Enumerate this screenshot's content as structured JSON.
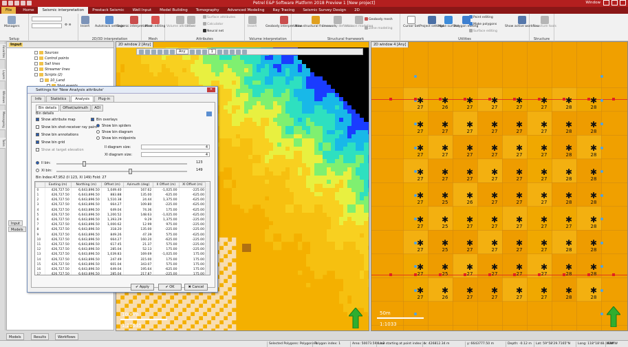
{
  "app": {
    "title": "Petrel E&P Software Platform 2018 Preview 1 [New project]",
    "window_menu": "Window",
    "quick_access_icons": [
      "save-icon",
      "undo-icon",
      "redo-icon",
      "print-icon",
      "folder-icon"
    ]
  },
  "tabs": [
    "File",
    "Home",
    "Seismic interpretation",
    "Prestack Seismic",
    "Well Input",
    "Model Building",
    "Tomography",
    "Advanced Modeling",
    "Ray Tracing",
    "Seismic Survey Design",
    "2D"
  ],
  "active_tab": "Seismic interpretation",
  "ribbon": {
    "groups": {
      "setup": "Setup",
      "interp": "2D/3D interpretation",
      "mesh": "Mesh",
      "attributes": "Attributes",
      "volume": "Volume interpretation",
      "structural": "Structural framework",
      "utilities": "Utilities",
      "structure": "Structure"
    },
    "buttons": {
      "managers": "Managers",
      "insert": "Insert",
      "autotrack": "Autotrack settings",
      "seismic_interp": "Seismic interpretation",
      "mesh_editing": "Mesh editing",
      "volume_attributes": "Volume attributes",
      "mixer": "Mixer",
      "surface_attributes": "Surface attributes",
      "calculator": "Calculator",
      "neural_net": "Neural net",
      "insert2": "Insert",
      "geobody_interp": "Geobody interpretation",
      "new_structural": "New structural framework",
      "geometry_def": "Geometry definition",
      "horizon_modeling": "Horizon modeling",
      "geobody_mesh": "Geobody mesh",
      "zone_modeling": "Zone modeling",
      "cursor_set": "Cursor Set",
      "project_settings": "Project settings",
      "make_surface": "Make surface",
      "polygon_editing": "Polygon editing",
      "point_editing": "Point editing",
      "make_polygons": "Make polygons",
      "surface_editing": "Surface editing",
      "show_active_workflow": "Show active workflow",
      "structure_tools": "Structure tools"
    }
  },
  "side_tabs": [
    "Favorites",
    "Layers",
    "Windows",
    "Messageing",
    "Tasks"
  ],
  "input_panel": {
    "title": "Input",
    "tree": [
      "Sources",
      "Control points",
      "Sail lines",
      "Streamer lines",
      "Scripts (2)",
      "10_Land",
      "Shot events"
    ],
    "bottom_tabs": [
      "Input",
      "Models"
    ]
  },
  "bottom_tabs": [
    "Models",
    "Results",
    "Workflows"
  ],
  "view_left": {
    "tab": "2D window 2 [Any]",
    "scale_distance": "1000m",
    "scale_ratio": "1:20535",
    "toolbar_any": "Any",
    "toolbar_one": "1"
  },
  "view_right": {
    "tab": "2D window 4 [Any]",
    "scale_distance": "50m",
    "scale_ratio": "1:1033",
    "bin_rows": [
      [
        27,
        26,
        27,
        27,
        27,
        27,
        28,
        28
      ],
      [
        27,
        27,
        27,
        27,
        27,
        27,
        28,
        28
      ],
      [
        27,
        27,
        27,
        27,
        27,
        27,
        28,
        28
      ],
      [
        27,
        27,
        27,
        27,
        27,
        27,
        28,
        28
      ],
      [
        27,
        25,
        26,
        27,
        27,
        27,
        28,
        28
      ],
      [
        27,
        25,
        27,
        27,
        27,
        27,
        27,
        28
      ],
      [
        27,
        25,
        27,
        27,
        27,
        27,
        28,
        28
      ],
      [
        27,
        25,
        27,
        27,
        27,
        27,
        28,
        28
      ],
      [
        27,
        26,
        27,
        27,
        27,
        27,
        28,
        28
      ]
    ]
  },
  "dialog": {
    "title": "Settings for 'New Analysis attribute'",
    "tabs": [
      "Info",
      "Statistics",
      "Analysis",
      "Plug-in"
    ],
    "active_tab": "Analysis",
    "subtabs": [
      "Bin details",
      "Offset/azimuth",
      "AOI"
    ],
    "active_subtab": "Bin details",
    "section_label": "Bin details",
    "left_checks": [
      {
        "label": "Show attribute map",
        "checked": true
      },
      {
        "label": "Show bin shot-receiver ray pairs",
        "checked": false
      },
      {
        "label": "Show bin annotations",
        "checked": true
      },
      {
        "label": "Show bin grid",
        "checked": true
      },
      {
        "label": "Show at target elevation",
        "checked": false
      }
    ],
    "bin_overlays_label": "Bin overlays",
    "bin_overlays_checked": true,
    "radios": [
      {
        "label": "Show bin spiders",
        "selected": true
      },
      {
        "label": "Show bin diagram",
        "selected": false
      },
      {
        "label": "Show bin midpoints",
        "selected": false
      }
    ],
    "il_diagram_label": "Il diagram size:",
    "il_diagram_value": "4",
    "xl_diagram_label": "Xl diagram size:",
    "xl_diagram_value": "4",
    "il_bin_label": "Il bin:",
    "il_bin_value": "123",
    "il_bin_fraction": 0.2,
    "xl_bin_label": "Xl bin:",
    "xl_bin_value": "149",
    "xl_bin_fraction": 0.55,
    "bin_index_text": "Bin Index:47,952 (Il 123, Xl 149) Fold: 27",
    "table": {
      "headers": [
        "",
        "Easting (m)",
        "Northing (m)",
        "Offset (m)",
        "Azimuth (deg)",
        "Il Offset (m)",
        "Xl Offset (m)"
      ],
      "rows": [
        [
          "0",
          "426,727.50",
          "6,643,896.50",
          "1,049.40",
          "167.62",
          "-1,025.00",
          "-225.00"
        ],
        [
          "1",
          "426,727.50",
          "6,643,896.50",
          "883.88",
          "135.00",
          "-625.00",
          "-625.00"
        ],
        [
          "2",
          "426,727.50",
          "6,643,896.50",
          "1,510.38",
          "24.44",
          "1,375.00",
          "-625.00"
        ],
        [
          "3",
          "426,727.50",
          "6,643,896.50",
          "664.27",
          "109.80",
          "-225.00",
          "-625.00"
        ],
        [
          "4",
          "426,727.50",
          "6,643,896.50",
          "649.04",
          "74.36",
          "175.00",
          "-625.00"
        ],
        [
          "5",
          "426,727.50",
          "6,643,896.50",
          "1,200.52",
          "148.63",
          "-1,025.00",
          "-625.00"
        ],
        [
          "6",
          "426,727.50",
          "6,643,896.50",
          "1,393.29",
          "9.29",
          "1,375.00",
          "-225.00"
        ],
        [
          "7",
          "426,727.50",
          "6,643,896.50",
          "1,000.62",
          "12.99",
          "975.00",
          "-225.00"
        ],
        [
          "8",
          "426,727.50",
          "6,643,896.50",
          "318.20",
          "135.00",
          "-225.00",
          "-225.00"
        ],
        [
          "9",
          "426,727.50",
          "6,643,896.50",
          "849.26",
          "47.39",
          "575.00",
          "-625.00"
        ],
        [
          "10",
          "426,727.50",
          "6,643,896.50",
          "664.27",
          "160.20",
          "-625.00",
          "-225.00"
        ],
        [
          "11",
          "426,727.50",
          "6,643,896.50",
          "617.45",
          "21.37",
          "575.00",
          "-225.00"
        ],
        [
          "12",
          "426,727.50",
          "6,643,896.50",
          "285.04",
          "52.13",
          "175.00",
          "-225.00"
        ],
        [
          "13",
          "426,727.50",
          "6,643,896.50",
          "1,039.83",
          "169.69",
          "-1,025.00",
          "175.00"
        ],
        [
          "14",
          "426,727.50",
          "6,643,896.50",
          "247.49",
          "315.00",
          "175.00",
          "175.00"
        ],
        [
          "15",
          "426,727.50",
          "6,643,896.50",
          "601.04",
          "343.07",
          "575.00",
          "175.00"
        ],
        [
          "16",
          "426,727.50",
          "6,643,896.50",
          "649.04",
          "195.64",
          "-625.00",
          "175.00"
        ],
        [
          "17",
          "426,727.50",
          "6,643,896.50",
          "285.04",
          "217.87",
          "-225.00",
          "175.00"
        ]
      ]
    },
    "apply": "Apply",
    "ok": "OK",
    "cancel": "Cancel"
  },
  "status": [
    "Selected Polygons: Polygone 1",
    "Polygon index: 1",
    "Area: 50073.594 m2",
    "Line starting at point index: 4",
    "x: 426812.34 m",
    "y: 6643777.50 m",
    "Depth: -0.12 m",
    "Lat: 59°58'29.7165\"N",
    "Long: 118°18'48.0838\"W",
    "RAM"
  ],
  "colors": {
    "title_red": "#b31f1f",
    "tab_bar": "#8a1717",
    "file_tab": "#e8b64a",
    "map_orange": "#f0a000",
    "north_arrow": "#2fae2f"
  }
}
